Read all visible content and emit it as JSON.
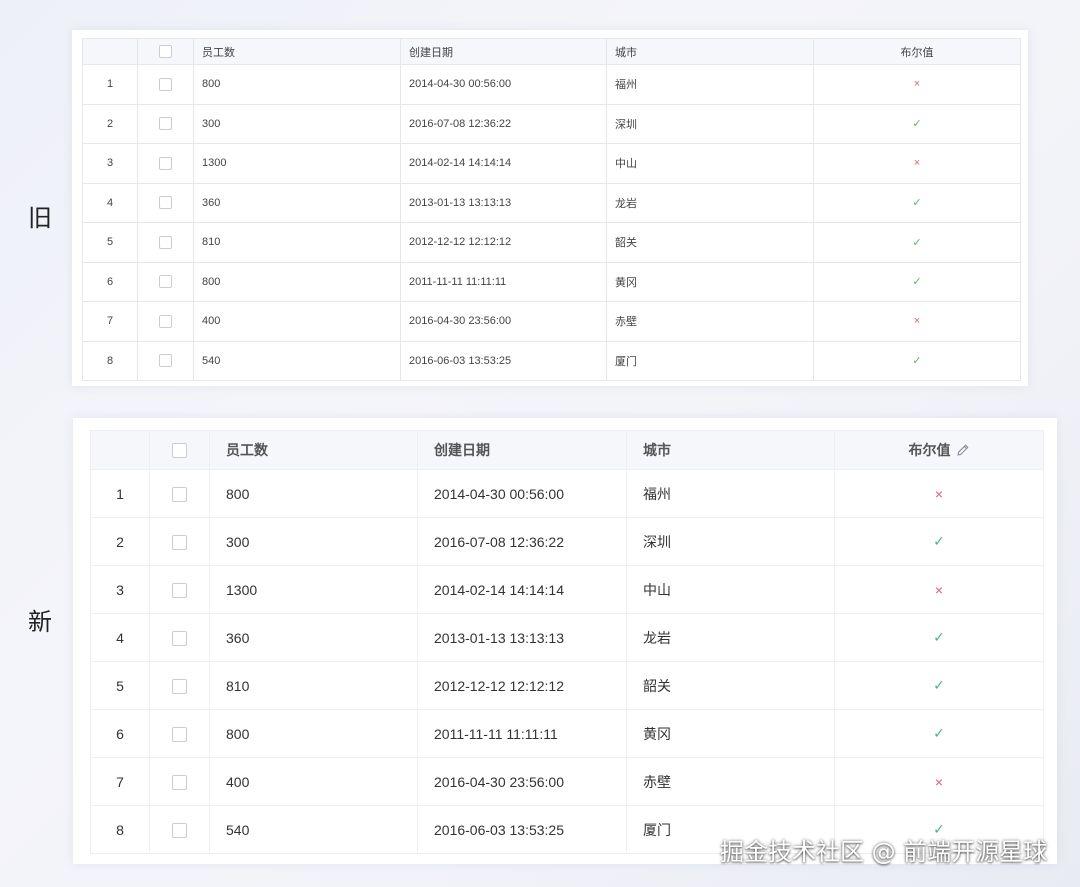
{
  "labels": {
    "old": "旧",
    "new": "新"
  },
  "columns": {
    "index": "",
    "employees": "员工数",
    "created": "创建日期",
    "city": "城市",
    "bool": "布尔值"
  },
  "rows": [
    {
      "index": "1",
      "employees": "800",
      "created": "2014-04-30 00:56:00",
      "city": "福州",
      "bool": "×"
    },
    {
      "index": "2",
      "employees": "300",
      "created": "2016-07-08 12:36:22",
      "city": "深圳",
      "bool": "✓"
    },
    {
      "index": "3",
      "employees": "1300",
      "created": "2014-02-14 14:14:14",
      "city": "中山",
      "bool": "×"
    },
    {
      "index": "4",
      "employees": "360",
      "created": "2013-01-13 13:13:13",
      "city": "龙岩",
      "bool": "✓"
    },
    {
      "index": "5",
      "employees": "810",
      "created": "2012-12-12 12:12:12",
      "city": "韶关",
      "bool": "✓"
    },
    {
      "index": "6",
      "employees": "800",
      "created": "2011-11-11 11:11:11",
      "city": "黄冈",
      "bool": "✓"
    },
    {
      "index": "7",
      "employees": "400",
      "created": "2016-04-30 23:56:00",
      "city": "赤壁",
      "bool": "×"
    },
    {
      "index": "8",
      "employees": "540",
      "created": "2016-06-03 13:53:25",
      "city": "厦门",
      "bool": "✓"
    }
  ],
  "icons": {
    "bool_header_edit": "pencil-icon",
    "true_mark": "check-icon",
    "false_mark": "cross-icon"
  },
  "colors": {
    "false_mark": "#e86060",
    "true_mark": "#4fb86a",
    "border": "#e4e7ec",
    "header_bg": "#f5f7fa"
  },
  "watermark": "掘金技术社区 @ 前端开源星球"
}
